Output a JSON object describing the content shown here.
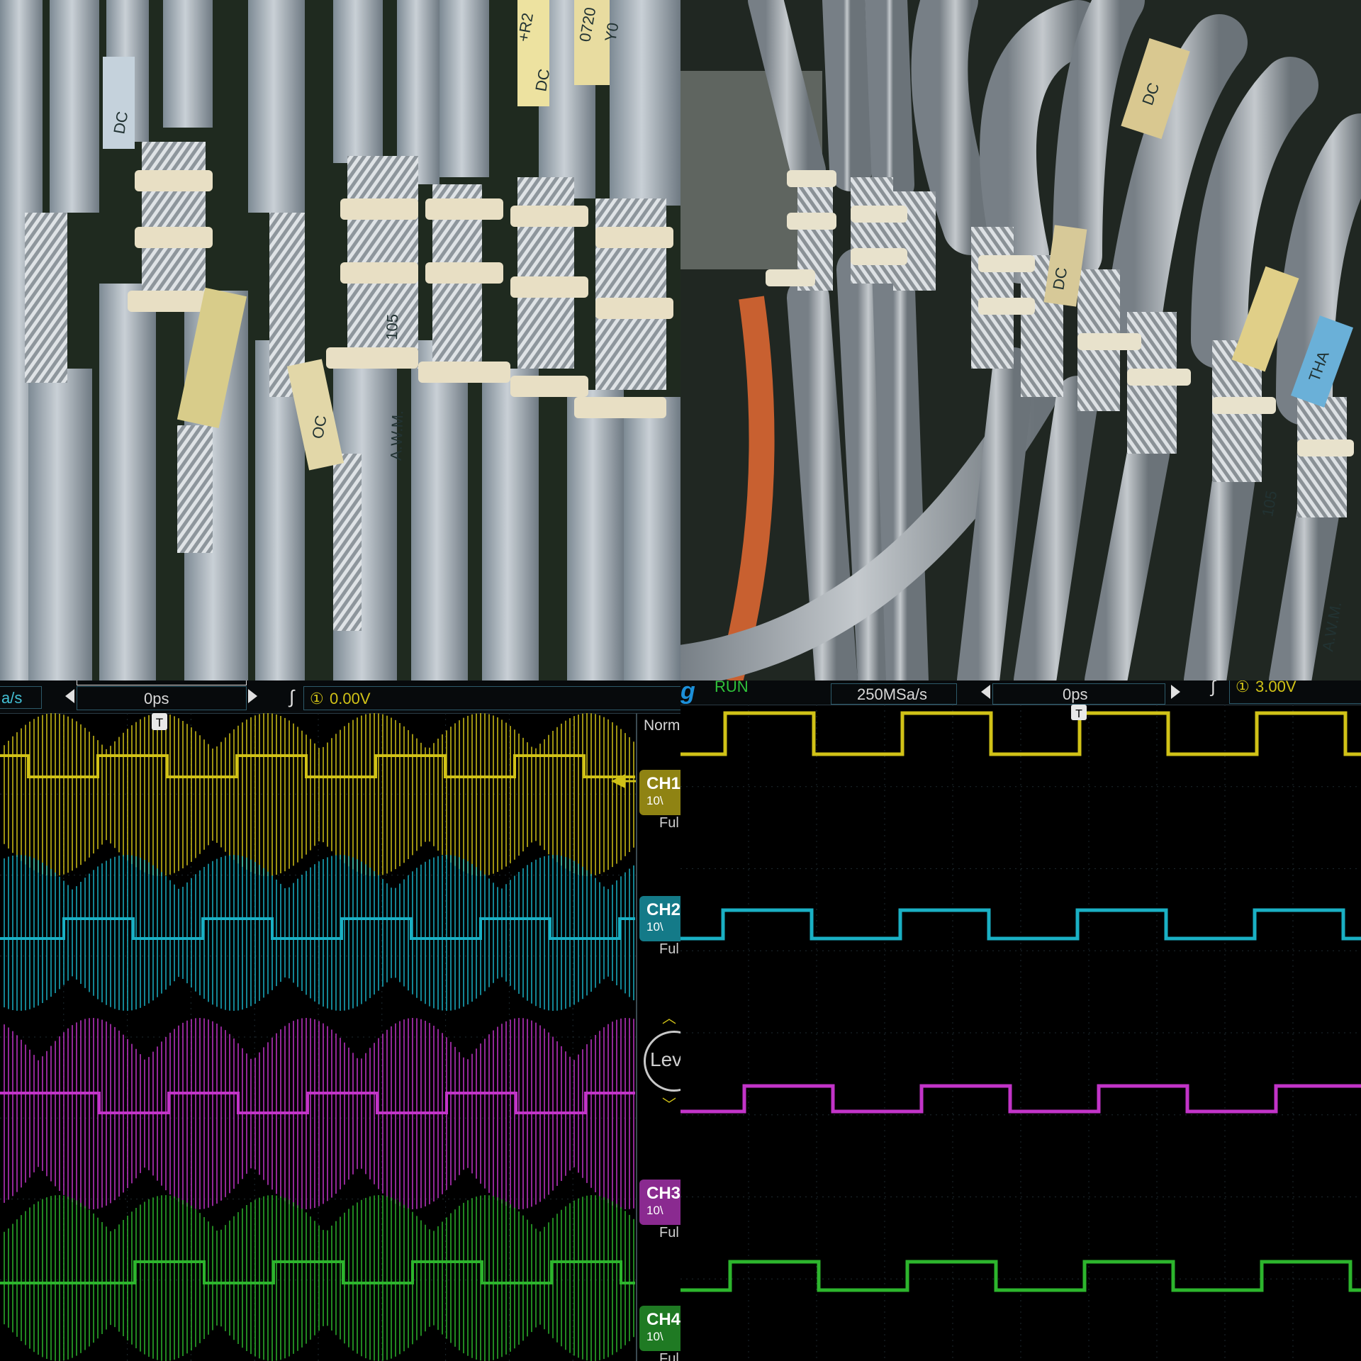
{
  "photos": {
    "top_left": {
      "labels": [
        "0720",
        "Y0",
        "+R2",
        "DC",
        "OC",
        "DC",
        "A.W.M.",
        "105"
      ]
    },
    "top_right": {
      "labels": [
        "DC",
        "DC",
        "THA",
        "105",
        "A.W.M."
      ]
    }
  },
  "scope_left": {
    "header": {
      "rate": "a/s",
      "time_offset": "0ps",
      "trigger_level": "0.00V",
      "trigger_source": "①"
    },
    "mode": "Norm",
    "channels": [
      {
        "name": "CH1",
        "scale": "10\\",
        "coupling": "Ful",
        "color": "#d1c217"
      },
      {
        "name": "CH2",
        "scale": "10\\",
        "coupling": "Ful",
        "color": "#1ab0c4"
      },
      {
        "name": "CH3",
        "scale": "10\\",
        "coupling": "Ful",
        "color": "#c234c8"
      },
      {
        "name": "CH4",
        "scale": "10\\",
        "coupling": "Ful",
        "color": "#2db52d"
      }
    ],
    "level_button": "Lev"
  },
  "scope_right": {
    "header": {
      "brand_fragment": "g",
      "status": "RUN",
      "sample_rate": "250MSa/s",
      "time_offset": "0ps",
      "trigger_level": "3.00V",
      "trigger_source": "①"
    }
  }
}
